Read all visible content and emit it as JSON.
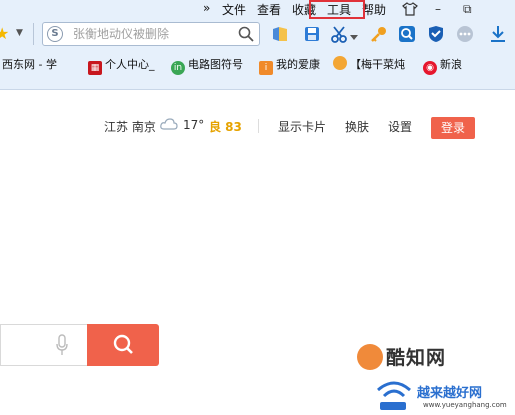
{
  "menubar": {
    "overflow": "»",
    "items": [
      {
        "label": "文件"
      },
      {
        "label": "查看"
      },
      {
        "label": "收藏"
      },
      {
        "label": "工具"
      },
      {
        "label": "帮助"
      }
    ],
    "highlighted": "工具"
  },
  "window_controls": {
    "minimize": "–",
    "restore": "⧉"
  },
  "toolbar": {
    "search_placeholder": "张衡地动仪被删除",
    "engine_icon": "S",
    "icons": [
      "bookmark-icon",
      "save-icon",
      "scissors-icon",
      "key-icon",
      "zoom-icon",
      "shield-icon",
      "more-icon",
      "download-icon"
    ]
  },
  "favorites": [
    {
      "label": "西东网 - 学",
      "icon": "西",
      "color": "#ffffff"
    },
    {
      "label": "个人中心_",
      "icon": "",
      "color": "#c8171e"
    },
    {
      "label": "电路图符号",
      "icon": "in",
      "color": "#3aa655"
    },
    {
      "label": "我的爱康",
      "icon": "i",
      "color": "#f08a2a"
    },
    {
      "label": "【梅干菜炖",
      "icon": "",
      "color": "#f3a634"
    },
    {
      "label": "新浪",
      "icon": "",
      "color": "#e6162d"
    }
  ],
  "page": {
    "location": "江苏 南京",
    "temperature": "17°",
    "air_quality": "良 83",
    "air_color": "#e6a300",
    "links": [
      "显示卡片",
      "换肤",
      "设置"
    ],
    "login": "登录",
    "accent": "#f0624b"
  },
  "watermark": {
    "site_name": "酷知网",
    "site2_name": "越来越好网",
    "site2_url": "www.yueyanghang.com"
  }
}
